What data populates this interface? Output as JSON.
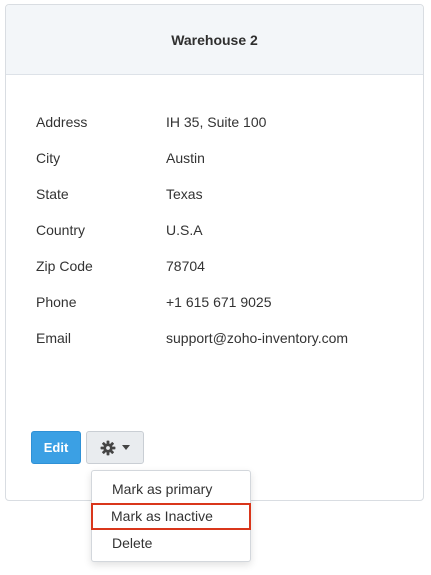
{
  "warehouse": {
    "title": "Warehouse 2"
  },
  "details": [
    {
      "label": "Address",
      "value": "IH 35, Suite 100"
    },
    {
      "label": "City",
      "value": "Austin"
    },
    {
      "label": "State",
      "value": "Texas"
    },
    {
      "label": "Country",
      "value": "U.S.A"
    },
    {
      "label": "Zip Code",
      "value": "78704"
    },
    {
      "label": "Phone",
      "value": "+1 615 671 9025"
    },
    {
      "label": "Email",
      "value": "support@zoho-inventory.com"
    }
  ],
  "actions": {
    "edit_label": "Edit",
    "settings_icon": "gear-icon",
    "dropdown_icon": "caret-down-icon"
  },
  "menu": {
    "items": [
      {
        "label": "Mark as primary"
      },
      {
        "label": "Mark as Inactive"
      },
      {
        "label": "Delete"
      }
    ],
    "highlighted_item": "Mark as Inactive"
  },
  "colors": {
    "edit_button": "#3ba0e4",
    "highlight_border": "#d9361b",
    "header_background": "#f3f6f9"
  }
}
